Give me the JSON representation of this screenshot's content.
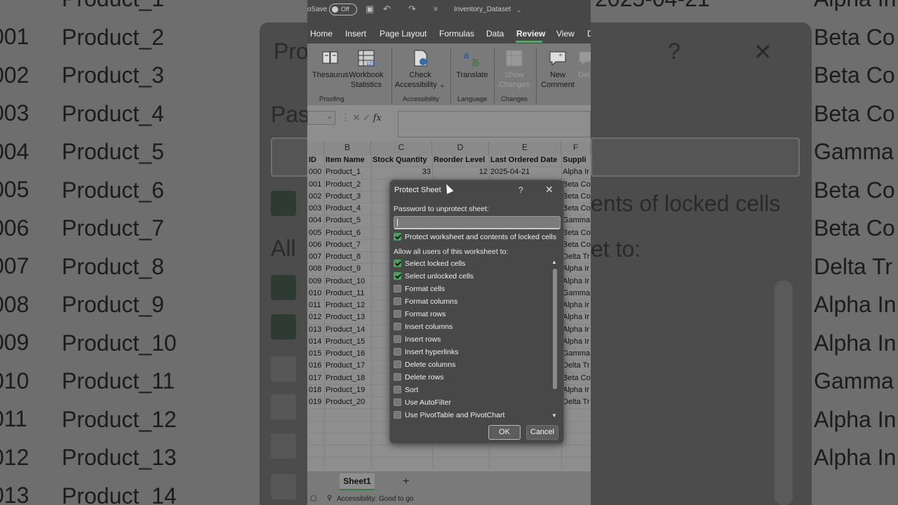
{
  "titlebar": {
    "autosave": "oSave",
    "toggle": "Off",
    "filename": "Inventory_Dataset"
  },
  "tabs": [
    "Home",
    "Insert",
    "Page Layout",
    "Formulas",
    "Data",
    "Review",
    "View",
    "D"
  ],
  "active_tab": "Review",
  "ribbon": {
    "thesaurus": "Thesaurus",
    "workbook_stats": [
      "Workbook",
      "Statistics"
    ],
    "check_accessibility": [
      "Check",
      "Accessibility"
    ],
    "translate": "Translate",
    "show_changes": [
      "Show",
      "Changes"
    ],
    "new_comment": [
      "New",
      "Comment"
    ],
    "delete": "Del",
    "groups": [
      "Proofing",
      "Accessibility",
      "Language",
      "Changes"
    ]
  },
  "formula_bar": {
    "fx": "fx",
    "cancel": "✕",
    "enter": "✓"
  },
  "columns": [
    "B",
    "C",
    "D",
    "E",
    "F"
  ],
  "header_row": [
    "ID",
    "Item Name",
    "Stock Quantity",
    "Reorder Level",
    "Last Ordered Date",
    "Suppli"
  ],
  "first_row": {
    "id": "000",
    "item": "Product_1",
    "stock": "33",
    "reorder": "12",
    "date": "2025-04-21",
    "supplier": "Alpha Ir"
  },
  "rows": [
    {
      "id": "000",
      "item": "Product_1",
      "supplier": "Alpha Ir"
    },
    {
      "id": "001",
      "item": "Product_2",
      "supplier": "Beta Co"
    },
    {
      "id": "002",
      "item": "Product_3",
      "supplier": "Beta Co"
    },
    {
      "id": "003",
      "item": "Product_4",
      "supplier": "Beta Co"
    },
    {
      "id": "004",
      "item": "Product_5",
      "supplier": "Gamma"
    },
    {
      "id": "005",
      "item": "Product_6",
      "supplier": "Beta Co"
    },
    {
      "id": "006",
      "item": "Product_7",
      "supplier": "Beta Co"
    },
    {
      "id": "007",
      "item": "Product_8",
      "supplier": "Delta Tr"
    },
    {
      "id": "008",
      "item": "Product_9",
      "supplier": "Alpha Ir"
    },
    {
      "id": "009",
      "item": "Product_10",
      "supplier": "Alpha Ir"
    },
    {
      "id": "010",
      "item": "Product_11",
      "supplier": "Gamma"
    },
    {
      "id": "011",
      "item": "Product_12",
      "supplier": "Alpha Ir"
    },
    {
      "id": "012",
      "item": "Product_13",
      "supplier": "Alpha Ir"
    },
    {
      "id": "013",
      "item": "Product_14",
      "supplier": "Alpha Ir"
    },
    {
      "id": "014",
      "item": "Product_15",
      "supplier": "Alpha Ir"
    },
    {
      "id": "015",
      "item": "Product_16",
      "supplier": "Gamma"
    },
    {
      "id": "016",
      "item": "Product_17",
      "supplier": "Delta Tr"
    },
    {
      "id": "017",
      "item": "Product_18",
      "supplier": "Beta Co"
    },
    {
      "id": "018",
      "item": "Product_19",
      "supplier": "Alpha Ir"
    },
    {
      "id": "019",
      "item": "Product_20",
      "supplier": "Delta Tr"
    }
  ],
  "sheet": {
    "tab": "Sheet1",
    "add": "+",
    "status": "Accessibility: Good to go"
  },
  "dialog": {
    "title": "Protect Sheet",
    "help": "?",
    "close": "✕",
    "password_label": "Password to unprotect sheet:",
    "password_value": "",
    "protect_label": "Protect worksheet and contents of locked cells",
    "protect_checked": true,
    "allow_label": "Allow all users of this worksheet to:",
    "options": [
      {
        "label": "Select locked cells",
        "checked": true
      },
      {
        "label": "Select unlocked cells",
        "checked": true
      },
      {
        "label": "Format cells",
        "checked": false
      },
      {
        "label": "Format columns",
        "checked": false
      },
      {
        "label": "Format rows",
        "checked": false
      },
      {
        "label": "Insert columns",
        "checked": false
      },
      {
        "label": "Insert rows",
        "checked": false
      },
      {
        "label": "Insert hyperlinks",
        "checked": false
      },
      {
        "label": "Delete columns",
        "checked": false
      },
      {
        "label": "Delete rows",
        "checked": false
      },
      {
        "label": "Sort",
        "checked": false
      },
      {
        "label": "Use AutoFilter",
        "checked": false
      },
      {
        "label": "Use PivotTable and PivotChart",
        "checked": false
      }
    ],
    "ok": "OK",
    "cancel": "Cancel"
  },
  "background_left": {
    "ids": [
      "001",
      "002",
      "003",
      "004",
      "005",
      "006",
      "007",
      "008",
      "009",
      "010",
      "011",
      "012",
      "013"
    ],
    "items": [
      "Product_1",
      "Product_2",
      "Product_3",
      "Product_4",
      "Product_5",
      "Product_6",
      "Product_7",
      "Product_8",
      "Product_9",
      "Product_10",
      "Product_11",
      "Product_12",
      "Product_13",
      "Product_14"
    ],
    "title_fragment": "Pro",
    "pass_fragment": "Pas",
    "allow_fragment": "All"
  },
  "background_right": {
    "suppliers": [
      "Alpha In",
      "Beta Co",
      "Beta Co",
      "Beta Co",
      "Gamma",
      "Beta Co",
      "Beta Co",
      "Delta Tr",
      "Alpha In",
      "Alpha In",
      "Gamma",
      "Alpha In",
      "Alpha In"
    ],
    "date_fragment": "2025-04-21",
    "help": "?",
    "close": "✕",
    "locked_fragment": "ents of locked cells",
    "allow_fragment": "et to:"
  },
  "colors": {
    "accent_green": "#4aa35c",
    "dialog_bg": "#484848"
  }
}
